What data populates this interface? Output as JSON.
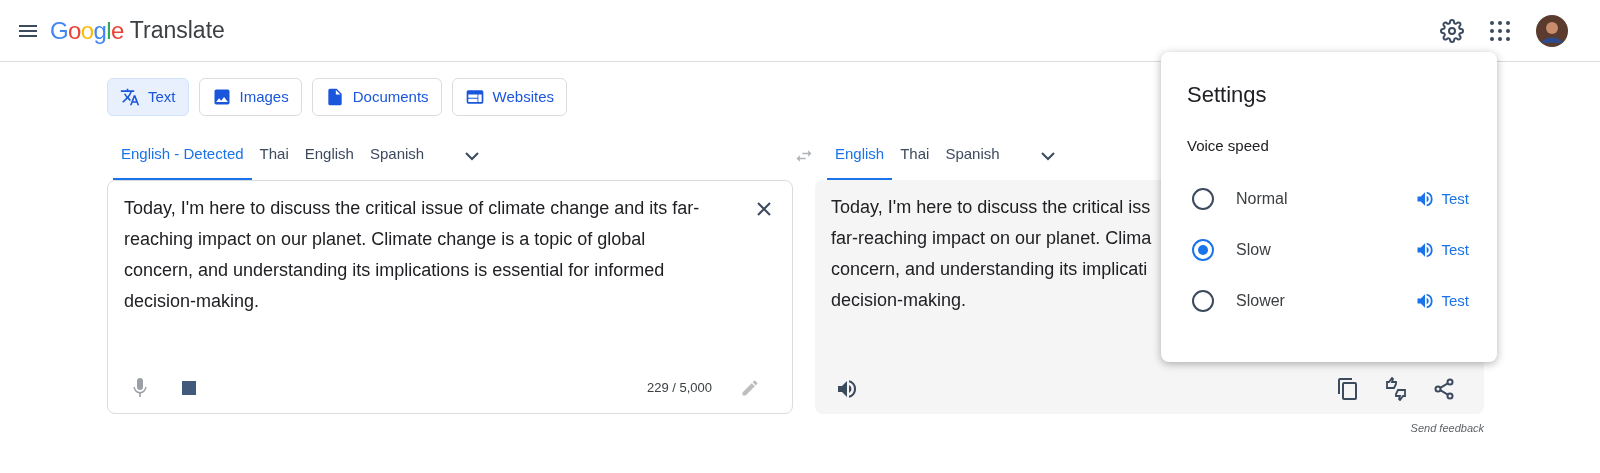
{
  "header": {
    "logo": "Google",
    "title": "Translate"
  },
  "modes": [
    {
      "label": "Text",
      "kind": "translate",
      "selected": true
    },
    {
      "label": "Images",
      "kind": "image",
      "selected": false
    },
    {
      "label": "Documents",
      "kind": "document",
      "selected": false
    },
    {
      "label": "Websites",
      "kind": "website",
      "selected": false
    }
  ],
  "source_languages": [
    {
      "label": "English - Detected",
      "selected": true
    },
    {
      "label": "Thai",
      "selected": false
    },
    {
      "label": "English",
      "selected": false
    },
    {
      "label": "Spanish",
      "selected": false
    }
  ],
  "target_languages": [
    {
      "label": "English",
      "selected": true
    },
    {
      "label": "Thai",
      "selected": false
    },
    {
      "label": "Spanish",
      "selected": false
    }
  ],
  "source": {
    "value": "Today, I'm here to discuss the critical issue of climate change and its far-reaching impact on our planet. Climate change is a topic of global concern, and understanding its implications is essential for informed decision-making.",
    "char_count": "229 / 5,000"
  },
  "target": {
    "lines": [
      "Today, I'm here to discuss the critical iss",
      "far-reaching impact on our planet. Clima",
      "concern, and understanding its implicati",
      "decision-making."
    ]
  },
  "send_feedback": "Send feedback",
  "settings": {
    "title": "Settings",
    "section": "Voice speed",
    "options": [
      {
        "label": "Normal",
        "selected": false,
        "test": "Test"
      },
      {
        "label": "Slow",
        "selected": true,
        "test": "Test"
      },
      {
        "label": "Slower",
        "selected": false,
        "test": "Test"
      }
    ]
  }
}
